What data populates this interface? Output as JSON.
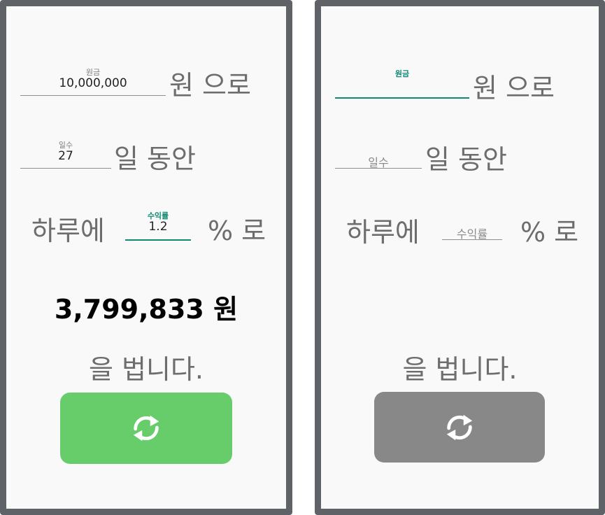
{
  "left": {
    "principal": {
      "hint": "원금",
      "value": "10,000,000",
      "suffix": "원 으로"
    },
    "days": {
      "hint": "일수",
      "value": "27",
      "suffix": "일 동안"
    },
    "rate": {
      "prefix": "하루에",
      "hint": "수익률",
      "value": "1.2",
      "suffix": "% 로"
    },
    "result": "3,799,833 원",
    "tail": "을 법니다.",
    "button": {
      "icon": "refresh-icon",
      "color": "#67cc6a"
    }
  },
  "right": {
    "principal": {
      "hint": "원금",
      "suffix": "원 으로"
    },
    "days": {
      "placeholder": "일수",
      "suffix": "일 동안"
    },
    "rate": {
      "prefix": "하루에",
      "placeholder": "수익률",
      "suffix": "% 로"
    },
    "tail": "을 법니다.",
    "button": {
      "icon": "refresh-icon",
      "color": "#888888"
    }
  },
  "colors": {
    "accent": "#0d8a74",
    "text": "#6d6d6d",
    "frame": "#5f6368"
  }
}
